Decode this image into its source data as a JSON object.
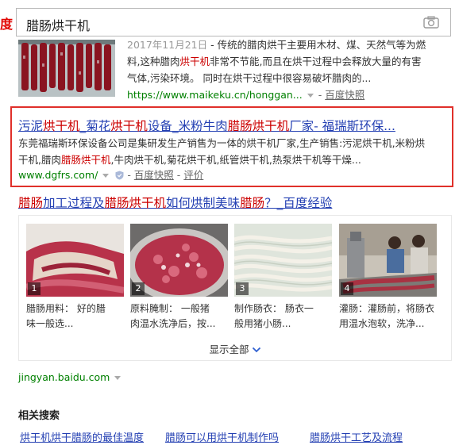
{
  "search": {
    "logo_fragment": "度",
    "query": "腊肠烘干机",
    "camera_icon": "camera-icon"
  },
  "result1": {
    "date": "2017年11月21日",
    "abstract_line1": " - 传统的腊肉烘干主要用木材、煤、天然气等为燃",
    "abstract_line2_a": "料,这种腊肉",
    "abstract_line2_hl": "烘干机",
    "abstract_line2_b": "非常不节能,而且在烘干过程中会释放大量的有害",
    "abstract_line3": "气体,污染环境。 同时在烘干过程中很容易破坏腊肉的...",
    "url": "https://www.maikeku.cn/honggan...",
    "snapshot": "百度快照"
  },
  "result2": {
    "title_parts": [
      "污泥",
      "烘干机",
      "_菊花",
      "烘干机",
      "设备_米粉牛肉",
      "腊肠烘干机",
      "厂家- 福瑞斯环保..."
    ],
    "abstract_line1": "东莞福瑞斯环保设备公司是集研发生产销售为一体的烘干机厂家,生产销售:污泥烘干机,米粉烘",
    "abstract_line2_a": "干机,腊肉",
    "abstract_line2_hl": "腊肠烘干机",
    "abstract_line2_b": ",牛肉烘干机,菊花烘干机,纸管烘干机,热泵烘干机等干燥...",
    "url": "www.dgfrs.com/",
    "snapshot": "百度快照",
    "rating": "评价"
  },
  "result3": {
    "title_parts": [
      "腊肠",
      "加工过程及",
      "腊肠烘干机",
      "如何烘制美味",
      "腊肠",
      "？_百度经验"
    ],
    "steps": [
      {
        "num": "1",
        "line1": "腊肠用料：  好的腊",
        "line2": "味一般选..."
      },
      {
        "num": "2",
        "line1": "原料腌制：  一般猪",
        "line2": "肉温水洗净后，按..."
      },
      {
        "num": "3",
        "line1": "制作肠衣：  肠衣一",
        "line2": "般用猪小肠..."
      },
      {
        "num": "4",
        "line1": "灌肠：灌肠前，将肠衣",
        "line2": "用温水泡软，洗净..."
      }
    ],
    "show_all": "显示全部",
    "url": "jingyan.baidu.com"
  },
  "related": {
    "heading": "相关搜索",
    "links": [
      "烘干机烘干腊肠的最佳温度",
      "腊肠可以用烘干机制作吗",
      "腊肠烘干工艺及流程"
    ]
  },
  "colors": {
    "link": "#2440b3",
    "highlight": "#c00",
    "url": "#008000",
    "box_border": "#e0302a"
  }
}
